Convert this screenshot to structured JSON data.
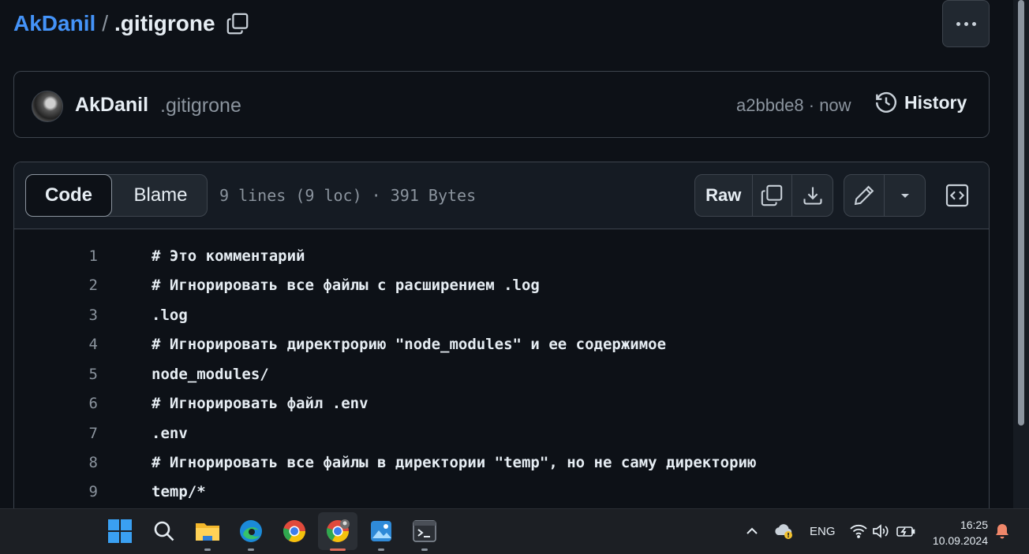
{
  "breadcrumb": {
    "owner": "AkDanil",
    "separator": "/",
    "file": ".gitigrone"
  },
  "commit": {
    "author": "AkDanil",
    "message": ".gitigrone",
    "meta": "a2bbde8 · now",
    "history_label": "History"
  },
  "file_header": {
    "tab_code": "Code",
    "tab_blame": "Blame",
    "info": "9 lines (9 loc) · 391 Bytes",
    "raw_label": "Raw"
  },
  "code_lines": [
    {
      "num": "1",
      "text": "# Это комментарий"
    },
    {
      "num": "2",
      "text": "# Игнорировать все файлы с расширением .log"
    },
    {
      "num": "3",
      "text": ".log"
    },
    {
      "num": "4",
      "text": "# Игнорировать директрорию \"node_modules\" и ее содержимое"
    },
    {
      "num": "5",
      "text": "node_modules/"
    },
    {
      "num": "6",
      "text": "# Игнорировать файл .env"
    },
    {
      "num": "7",
      "text": ".env"
    },
    {
      "num": "8",
      "text": "# Игнорировать все файлы в директории \"temp\", но не саму директорию"
    },
    {
      "num": "9",
      "text": "temp/*"
    }
  ],
  "taskbar": {
    "apps": [
      "windows-start",
      "search",
      "file-explorer",
      "edge",
      "chrome",
      "chrome-profile",
      "photos",
      "terminal"
    ],
    "language": "ENG",
    "time": "16:25",
    "date": "10.09.2024"
  },
  "colors": {
    "background": "#0d1117",
    "link": "#4493f8",
    "border": "#3d444d",
    "muted": "#8b949e"
  }
}
